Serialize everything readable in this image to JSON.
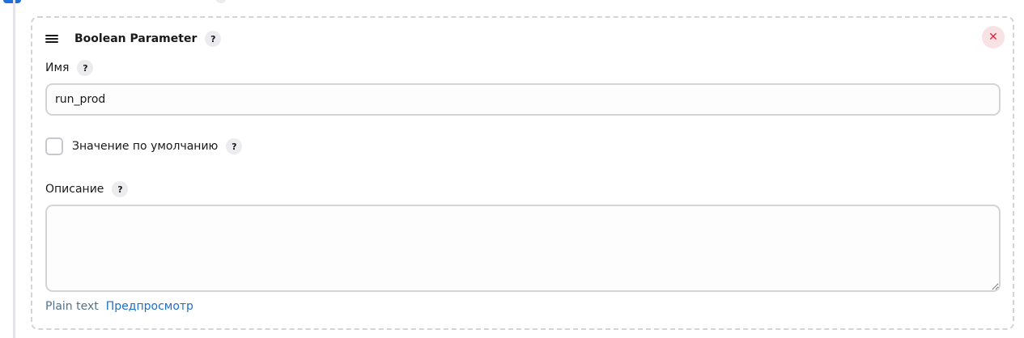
{
  "card": {
    "title": "Boolean Parameter",
    "help_glyph": "?",
    "close_glyph": "✕"
  },
  "name_field": {
    "label": "Имя",
    "value": "run_prod"
  },
  "default_checkbox": {
    "label": "Значение по умолчанию",
    "checked": false
  },
  "description_field": {
    "label": "Описание",
    "value": ""
  },
  "format": {
    "plain_text": "Plain text",
    "preview_link": "Предпросмотр"
  },
  "icons": {
    "drag": "drag-handle-icon",
    "help": "help-icon",
    "close": "close-icon"
  },
  "colors": {
    "accent": "#1c6fcb",
    "close_bg": "#f9e2e4",
    "close_fg": "#d9263a",
    "border": "#d4d4d8"
  }
}
